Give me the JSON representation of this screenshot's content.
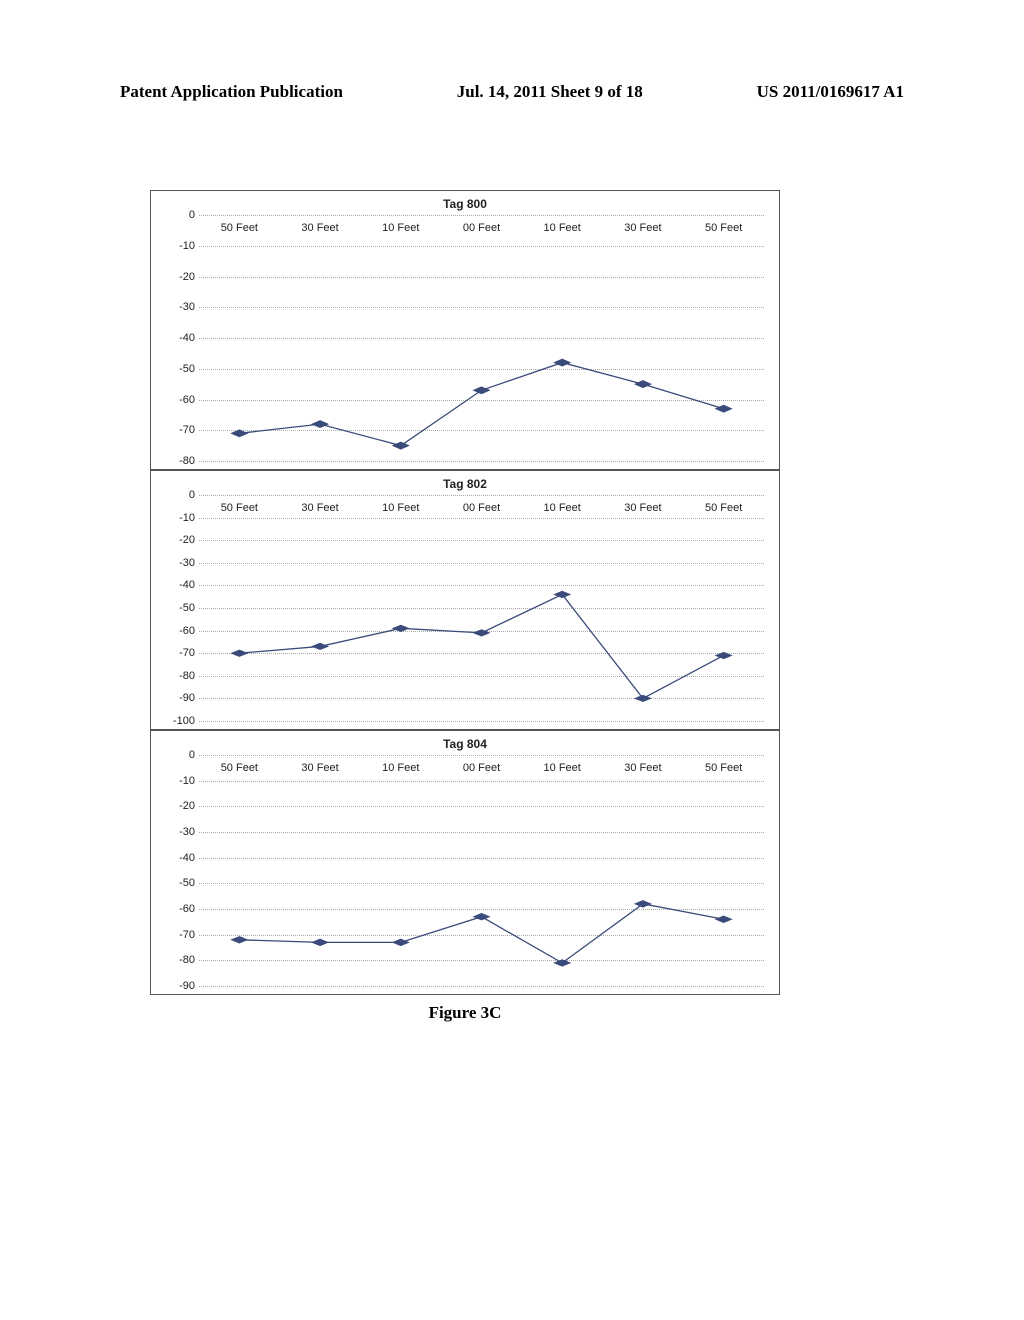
{
  "header": {
    "left": "Patent Application Publication",
    "center": "Jul. 14, 2011  Sheet 9 of 18",
    "right": "US 2011/0169617 A1"
  },
  "caption": "Figure 3C",
  "chart_data": [
    {
      "type": "line",
      "title": "Tag 800",
      "categories": [
        "50 Feet",
        "30 Feet",
        "10 Feet",
        "00 Feet",
        "10 Feet",
        "30 Feet",
        "50 Feet"
      ],
      "values": [
        -71,
        -68,
        -75,
        -57,
        -48,
        -55,
        -63
      ],
      "ylim": [
        -80,
        0
      ],
      "ystep": 10
    },
    {
      "type": "line",
      "title": "Tag 802",
      "categories": [
        "50 Feet",
        "30 Feet",
        "10 Feet",
        "00 Feet",
        "10 Feet",
        "30 Feet",
        "50 Feet"
      ],
      "values": [
        -70,
        -67,
        -59,
        -61,
        -44,
        -90,
        -71
      ],
      "ylim": [
        -100,
        0
      ],
      "ystep": 10
    },
    {
      "type": "line",
      "title": "Tag 804",
      "categories": [
        "50 Feet",
        "30 Feet",
        "10 Feet",
        "00 Feet",
        "10 Feet",
        "30 Feet",
        "50 Feet"
      ],
      "values": [
        -72,
        -73,
        -73,
        -63,
        -81,
        -58,
        -64
      ],
      "ylim": [
        -90,
        0
      ],
      "ystep": 10
    }
  ]
}
